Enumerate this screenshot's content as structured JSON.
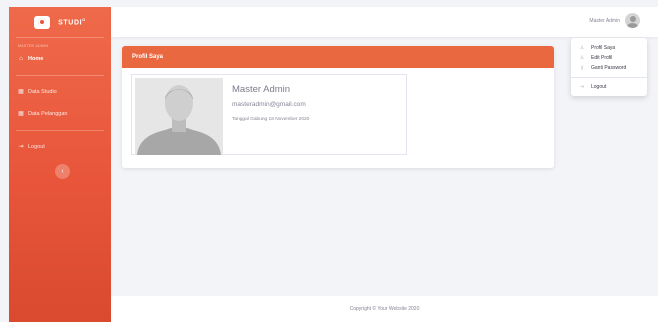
{
  "app": {
    "brand": "STUDI",
    "brand_sup": "O"
  },
  "sidebar": {
    "heading": "MASTER ADMIN",
    "items": [
      {
        "label": "Home",
        "icon": "home-icon"
      },
      {
        "label": "Data Studio",
        "icon": "table-icon"
      },
      {
        "label": "Data Pelanggan",
        "icon": "table-icon"
      },
      {
        "label": "Logout",
        "icon": "logout-icon"
      }
    ],
    "toggle_glyph": "‹"
  },
  "topbar": {
    "user_name": "Master Admin"
  },
  "dropdown": {
    "items": [
      {
        "label": "Profil Saya",
        "icon": "user-icon"
      },
      {
        "label": "Edit Profil",
        "icon": "user-edit-icon"
      },
      {
        "label": "Ganti Password",
        "icon": "key-icon"
      },
      {
        "label": "Logout",
        "icon": "logout-icon"
      }
    ]
  },
  "card": {
    "title": "Profil Saya",
    "name": "Master Admin",
    "email": "masteradmin@gmail.com",
    "joined": "Tanggal Gabung 18 November 2020"
  },
  "footer": {
    "copyright": "Copyright © Your Website 2020"
  },
  "colors": {
    "accent": "#ea6840",
    "sidebar": "#e8553a",
    "background": "#f3f4f7"
  }
}
